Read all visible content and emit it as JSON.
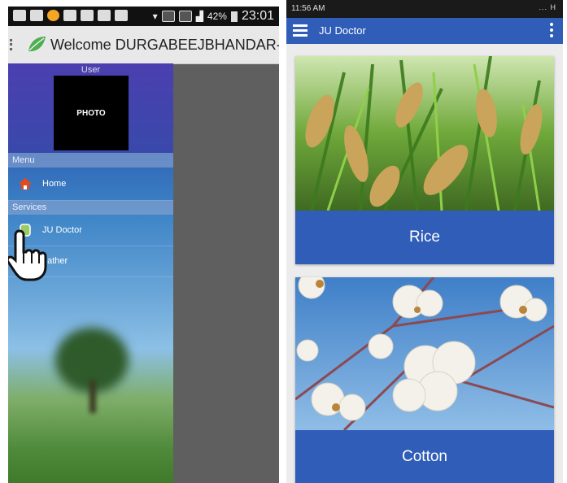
{
  "left_phone": {
    "status_bar": {
      "battery": "42%",
      "time": "23:01"
    },
    "app_bar": {
      "title": "Welcome DURGABEEJBHANDAR-F..."
    },
    "drawer": {
      "user_label": "User",
      "photo_label": "PHOTO",
      "menu_section": "Menu",
      "menu_items": [
        {
          "label": "Home",
          "icon": "home-icon"
        }
      ],
      "services_section": "Services",
      "service_items": [
        {
          "label": "JU Doctor",
          "icon": "doctor-icon"
        },
        {
          "label": "eather",
          "icon": "weather-icon"
        }
      ]
    }
  },
  "right_phone": {
    "status_bar": {
      "time": "11:56 AM",
      "signal": "... H"
    },
    "app_bar": {
      "title": "JU Doctor"
    },
    "cards": [
      {
        "label": "Rice"
      },
      {
        "label": "Cotton"
      }
    ]
  },
  "colors": {
    "accent": "#2f5db8",
    "drawer_header": "#3949ab"
  }
}
